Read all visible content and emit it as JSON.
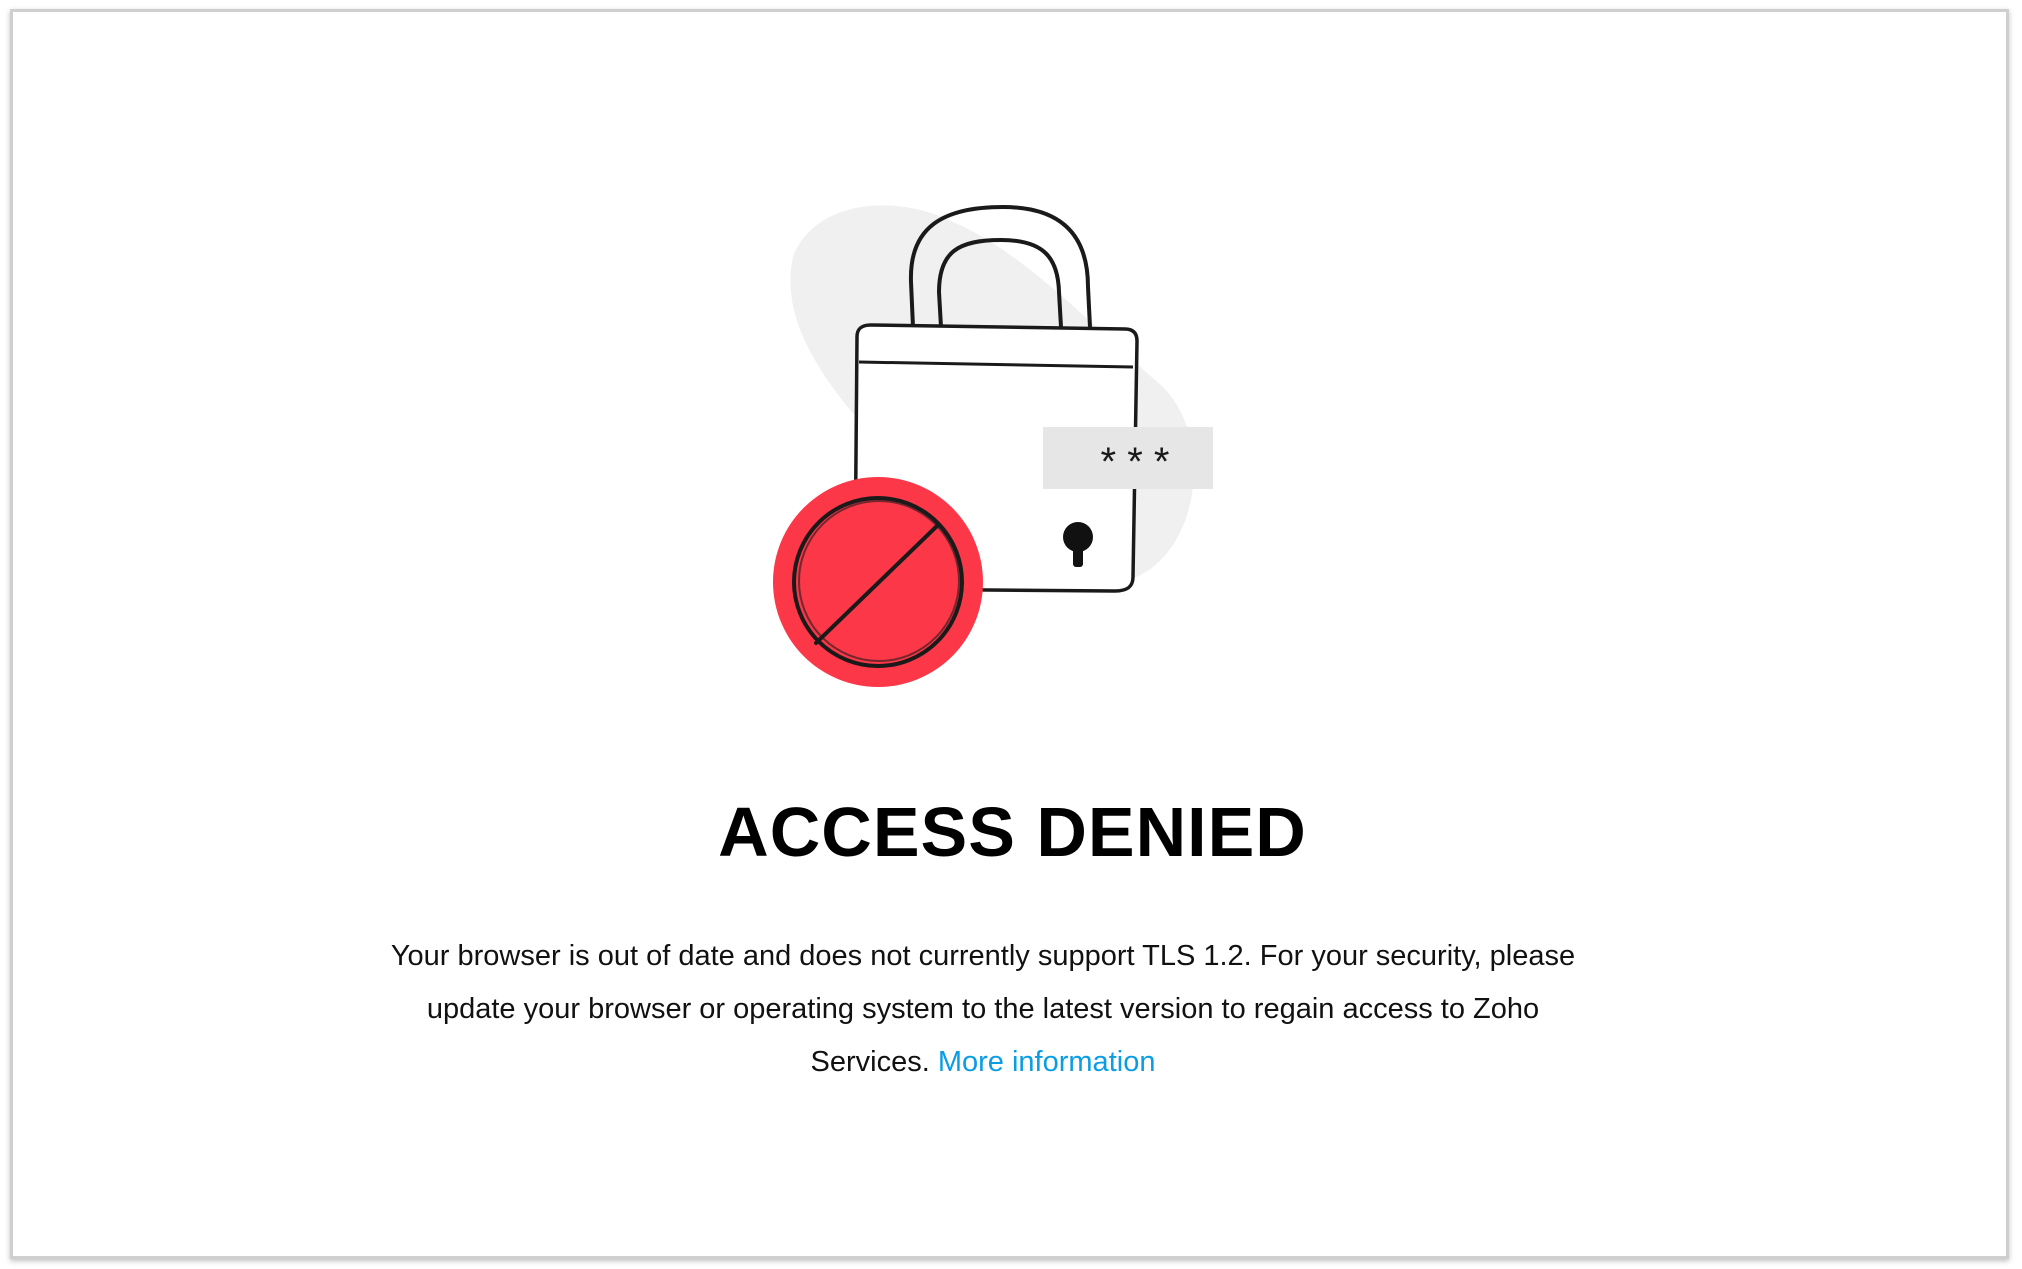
{
  "page": {
    "title": "ACCESS DENIED",
    "message_part1": "Your browser is out of date and does not currently support TLS 1.2. For your security, please update your browser or operating system to the latest version to regain access to Zoho Services.",
    "link_label": "More information"
  },
  "illustration": {
    "icon": "locked-padlock-icon",
    "blocked_icon": "prohibited-sign-icon",
    "password_mask": "* * *",
    "colors": {
      "blob": "#f0f0f0",
      "stroke": "#1a1a1a",
      "prohibited_red": "#fb3748",
      "password_box": "#e6e6e6"
    }
  },
  "theme": {
    "link_color": "#0b9de3"
  }
}
